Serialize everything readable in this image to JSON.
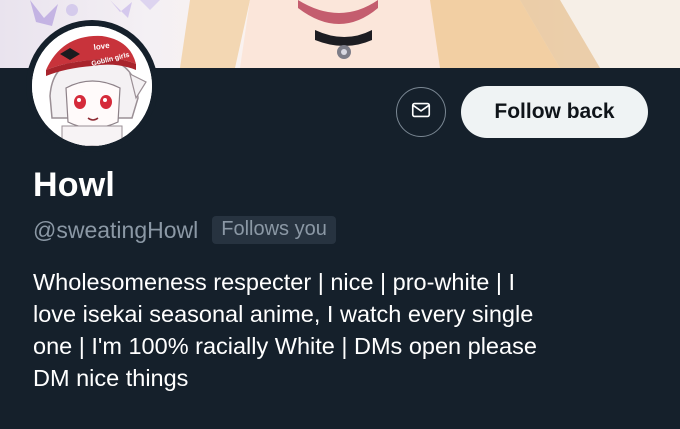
{
  "profile": {
    "display_name": "Howl",
    "handle": "@sweatingHowl",
    "follows_you_badge": "Follows you",
    "bio_lines": [
      "Wholesomeness respecter | nice | pro-white | I",
      "love isekai seasonal anime, I watch every single",
      "one | I'm 100% racially White | DMs open please",
      "DM nice things"
    ]
  },
  "actions": {
    "follow_back_label": "Follow back",
    "message_icon": "envelope-icon"
  },
  "avatar": {
    "hat_text_top": "love",
    "hat_text_bottom": "Goblin girls"
  },
  "theme": {
    "background": "#15202b",
    "muted_text": "#8b98a5",
    "button_bg": "#eff3f4"
  }
}
